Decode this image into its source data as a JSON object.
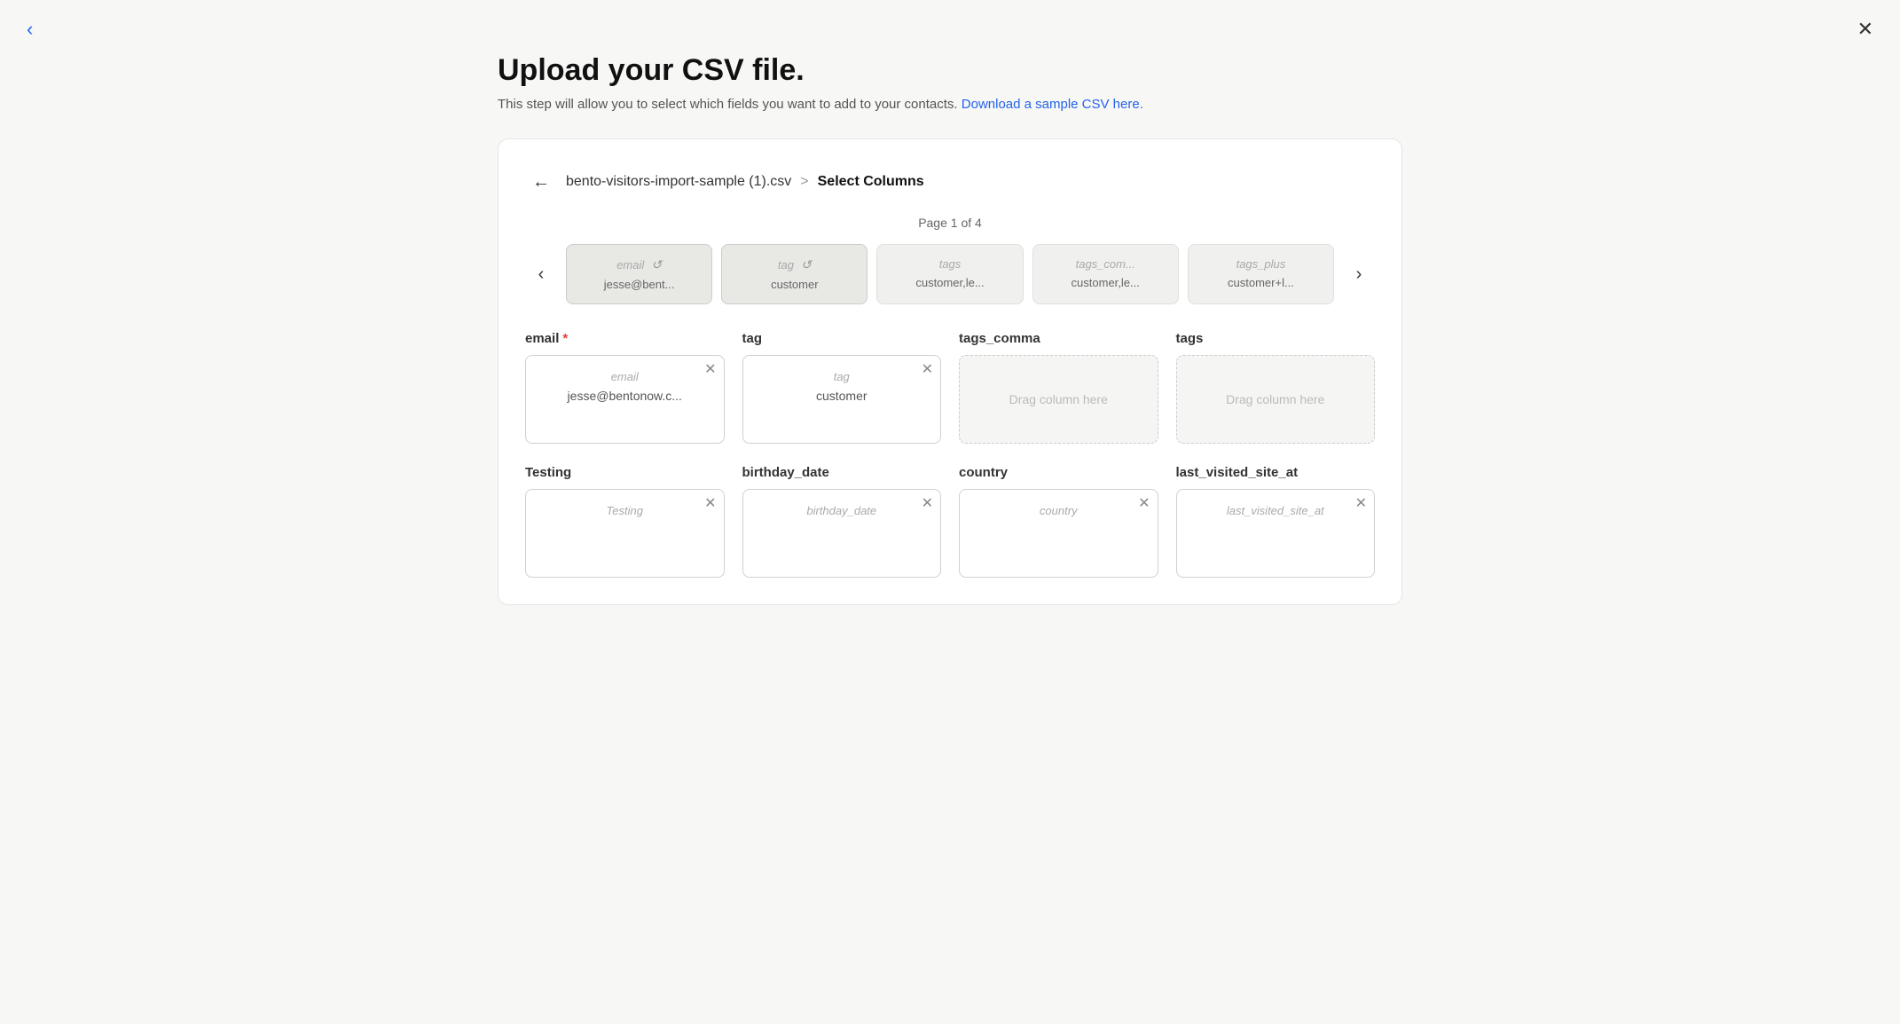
{
  "page": {
    "title": "Upload your CSV file.",
    "subtitle": "This step will allow you to select which fields you want to add to your contacts.",
    "download_link": "Download a sample CSV here.",
    "close_label": "×",
    "back_label": "‹"
  },
  "breadcrumb": {
    "filename": "bento-visitors-import-sample (1).csv",
    "separator": ">",
    "current": "Select Columns"
  },
  "carousel": {
    "page_indicator": "Page 1 of 4",
    "prev_label": "‹",
    "next_label": "›",
    "items": [
      {
        "id": "email-col",
        "header": "email",
        "value": "jesse@bent...",
        "selected": true
      },
      {
        "id": "tag-col",
        "header": "tag",
        "value": "customer",
        "selected": true
      },
      {
        "id": "tags-col",
        "header": "tags",
        "value": "customer,le..."
      },
      {
        "id": "tags-com-col",
        "header": "tags_com...",
        "value": "customer,le..."
      },
      {
        "id": "tags-plus-col",
        "header": "tags_plus",
        "value": "customer+l..."
      }
    ]
  },
  "dropzones": [
    {
      "id": "email-zone",
      "label": "email",
      "required": true,
      "filled": true,
      "tag_label": "email",
      "tag_value": "jesse@bentonow.c..."
    },
    {
      "id": "tag-zone",
      "label": "tag",
      "required": false,
      "filled": true,
      "tag_label": "tag",
      "tag_value": "customer"
    },
    {
      "id": "tags-comma-zone",
      "label": "tags_comma",
      "required": false,
      "filled": false,
      "placeholder": "Drag column here"
    },
    {
      "id": "tags-zone",
      "label": "tags",
      "required": false,
      "filled": false,
      "placeholder": "Drag column here"
    },
    {
      "id": "testing-zone",
      "label": "Testing",
      "required": false,
      "filled": true,
      "tag_label": "Testing",
      "tag_value": ""
    },
    {
      "id": "birthday-zone",
      "label": "birthday_date",
      "required": false,
      "filled": true,
      "tag_label": "birthday_date",
      "tag_value": ""
    },
    {
      "id": "country-zone",
      "label": "country",
      "required": false,
      "filled": true,
      "tag_label": "country",
      "tag_value": ""
    },
    {
      "id": "last-visited-zone",
      "label": "last_visited_site_at",
      "required": false,
      "filled": true,
      "tag_label": "last_visited_site_at",
      "tag_value": ""
    }
  ],
  "icons": {
    "close": "✕",
    "back_top": "‹",
    "back_breadcrumb": "←",
    "refresh": "↺",
    "remove": "✕",
    "prev": "‹",
    "next": "›"
  }
}
